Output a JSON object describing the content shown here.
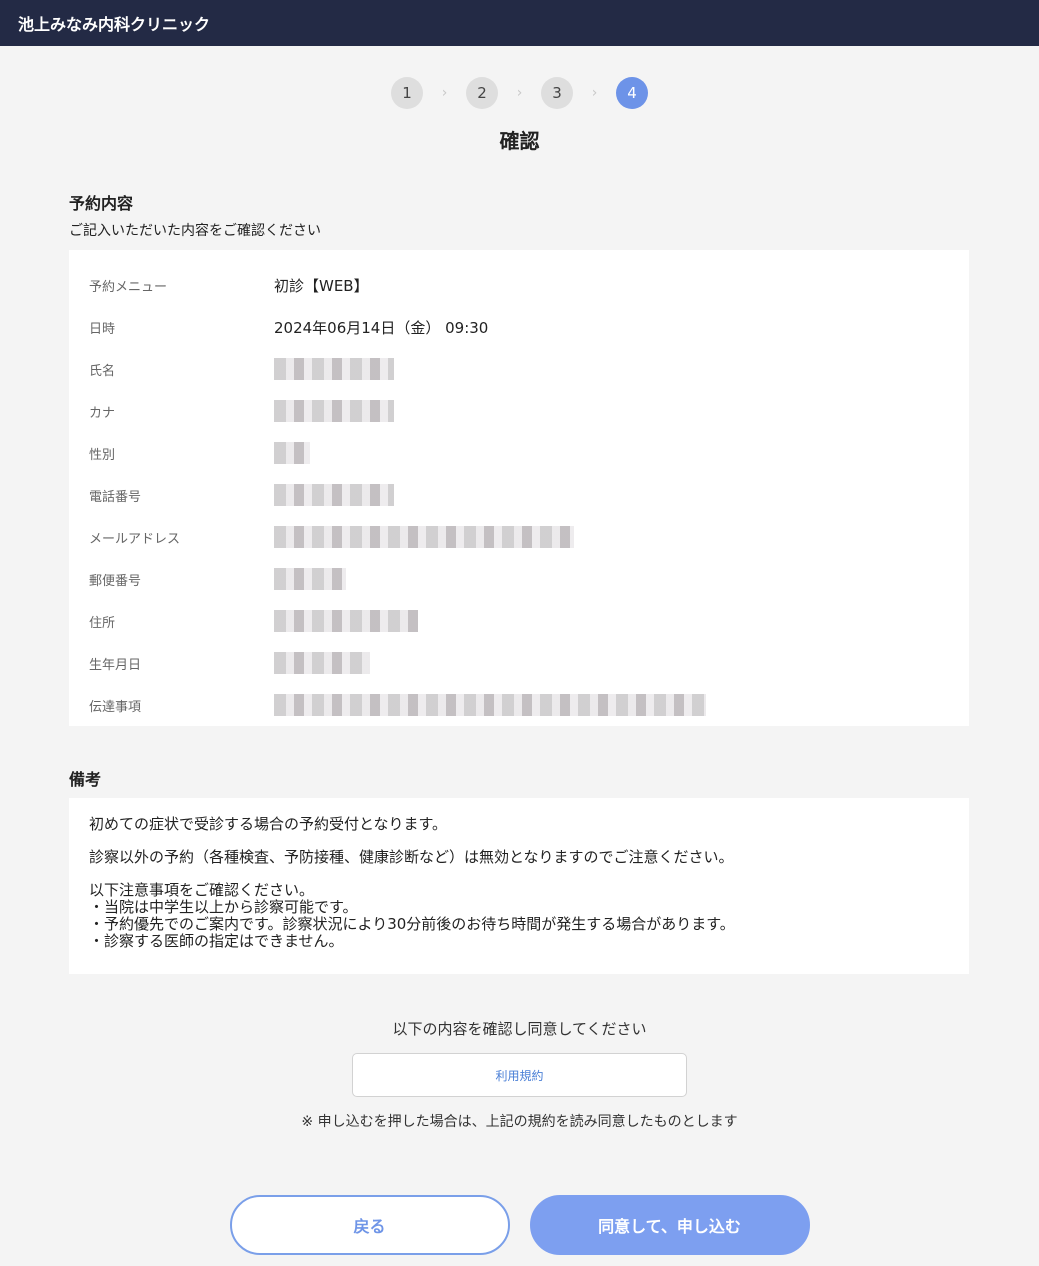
{
  "header": {
    "clinic_name": "池上みなみ内科クリニック"
  },
  "steps": {
    "items": [
      "1",
      "2",
      "3",
      "4"
    ],
    "active": 3
  },
  "page_title": "確認",
  "reservation": {
    "title": "予約内容",
    "subtitle": "ご記入いただいた内容をご確認ください",
    "rows": [
      {
        "label": "予約メニュー",
        "value": "初診【WEB】"
      },
      {
        "label": "日時",
        "value": "2024年06月14日（金） 09:30"
      },
      {
        "label": "氏名",
        "value": ""
      },
      {
        "label": "カナ",
        "value": ""
      },
      {
        "label": "性別",
        "value": ""
      },
      {
        "label": "電話番号",
        "value": ""
      },
      {
        "label": "メールアドレス",
        "value": ""
      },
      {
        "label": "郵便番号",
        "value": ""
      },
      {
        "label": "住所",
        "value": ""
      },
      {
        "label": "生年月日",
        "value": ""
      },
      {
        "label": "伝達事項",
        "value": ""
      }
    ]
  },
  "remarks": {
    "title": "備考",
    "line1": "初めての症状で受診する場合の予約受付となります。",
    "line2": "診察以外の予約（各種検査、予防接種、健康診断など）は無効となりますのでご注意ください。",
    "line3": "以下注意事項をご確認ください。",
    "bullets": [
      "・当院は中学生以上から診察可能です。",
      "・予約優先でのご案内です。診察状況により30分前後のお待ち時間が発生する場合があります。",
      "・診察する医師の指定はできません。"
    ]
  },
  "consent": {
    "prompt": "以下の内容を確認し同意してください",
    "terms_label": "利用規約",
    "note": "※ 申し込むを押した場合は、上記の規約を読み同意したものとします"
  },
  "actions": {
    "back_label": "戻る",
    "submit_label": "同意して、申し込む"
  },
  "colors": {
    "header_bg": "#232a45",
    "accent": "#6d93e8"
  }
}
